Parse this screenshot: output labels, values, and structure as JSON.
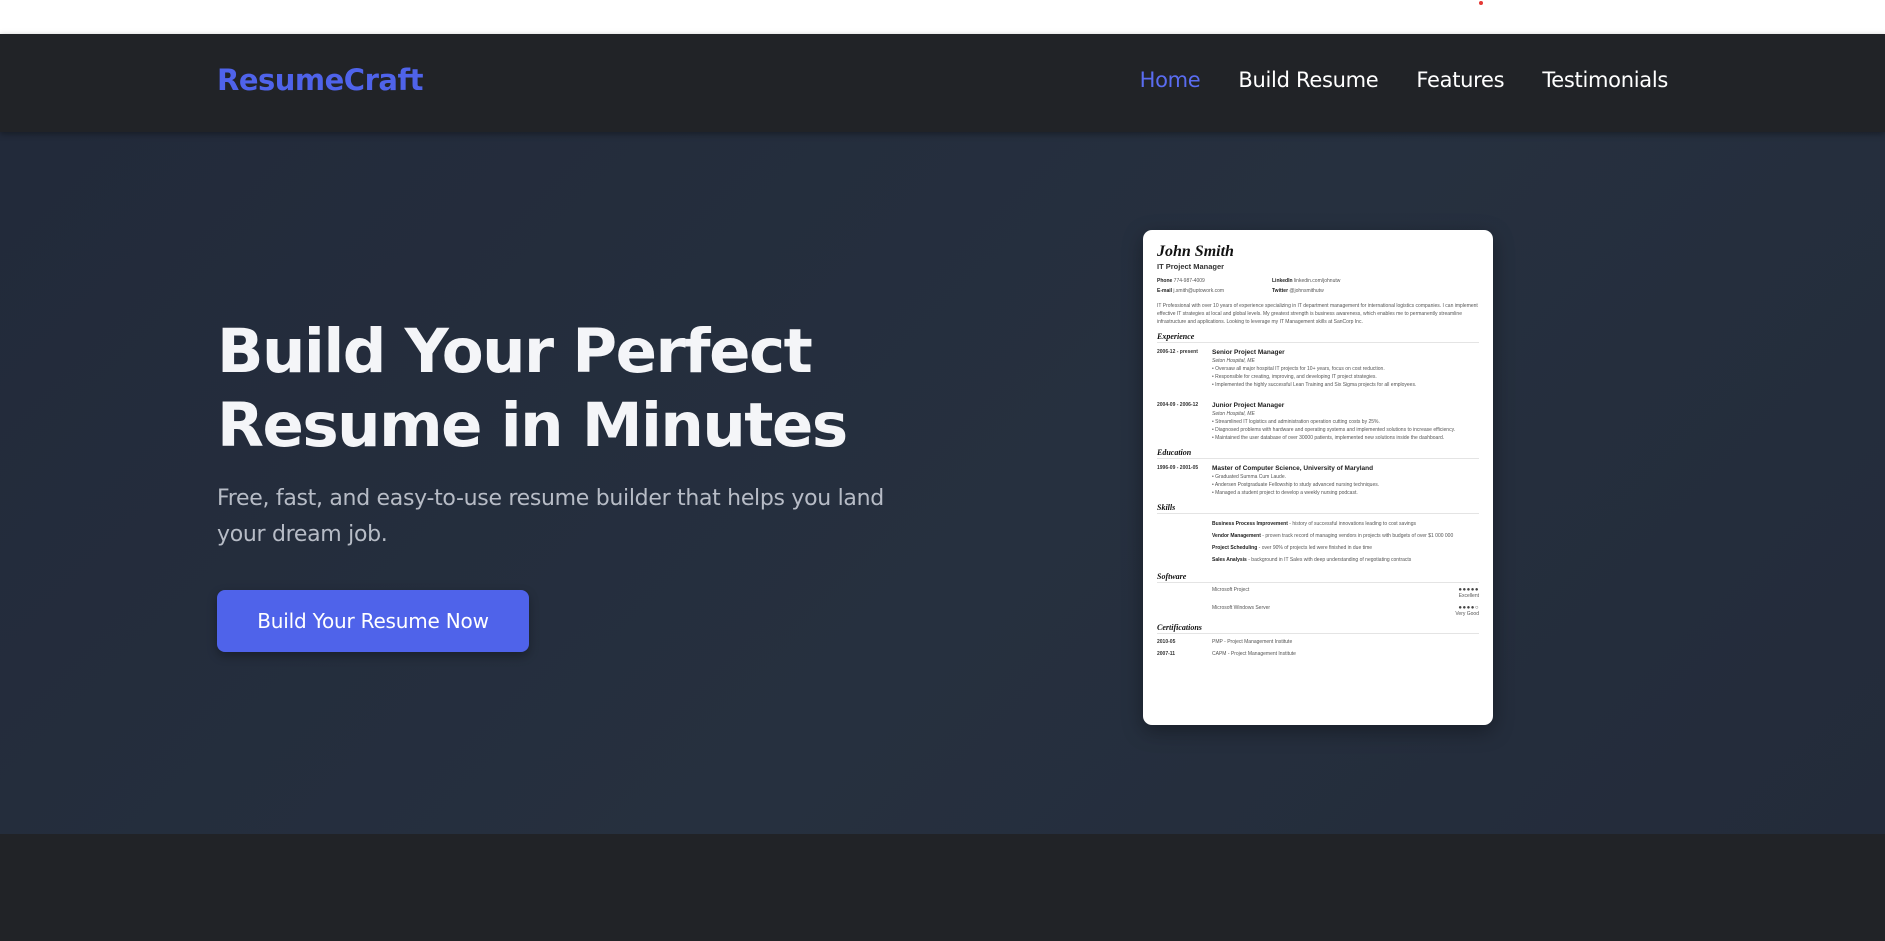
{
  "brand": {
    "logo": "ResumeCraft"
  },
  "nav": {
    "items": [
      "Home",
      "Build Resume",
      "Features",
      "Testimonials"
    ],
    "active": "Home"
  },
  "hero": {
    "title_line1": "Build Your Perfect",
    "title_line2": "Resume in Minutes",
    "subtitle": "Free, fast, and easy-to-use resume builder that helps you land your dream job.",
    "cta_label": "Build Your Resume Now"
  },
  "resume_preview": {
    "name": "John Smith",
    "role": "IT Project Manager",
    "contacts": {
      "phone_label": "Phone",
      "phone": "774-987-4009",
      "linkedin_label": "LinkedIn",
      "linkedin": "linkedin.com/johnutw",
      "email_label": "E-mail",
      "email": "j.smith@uptowork.com",
      "twitter_label": "Twitter",
      "twitter": "@johnsmithutw"
    },
    "summary": "IT Professional with over 10 years of experience specializing in IT department management for international logistics companies. I can implement effective IT strategies at local and global levels. My greatest strength is business awareness, which enables me to permanently streamline infrastructure and applications. Looking to leverage my IT Management skills at SanCorp Inc.",
    "sections": {
      "experience": "Experience",
      "education": "Education",
      "skills": "Skills",
      "software": "Software",
      "certifications": "Certifications"
    },
    "experience": [
      {
        "dates": "2006-12 - present",
        "title": "Senior Project Manager",
        "place": "Seton Hospital, ME",
        "bullets": [
          "• Oversaw all major hospital IT projects for 10+ years, focus on cost reduction.",
          "• Responsible for creating, improving, and developing IT project strategies.",
          "• Implemented the highly successful Lean Training and Six Sigma projects for all employees."
        ]
      },
      {
        "dates": "2004-09 - 2006-12",
        "title": "Junior Project Manager",
        "place": "Seton Hospital, ME",
        "bullets": [
          "• Streamlined IT logistics and administration operation cutting costs by 25%.",
          "• Diagnosed problems with hardware and operating systems and implemented solutions to increase efficiency.",
          "• Maintained the user database of over 30000 patients, implemented new solutions inside the dashboard."
        ]
      }
    ],
    "education": [
      {
        "dates": "1996-09 - 2001-05",
        "title": "Master of Computer Science, University of Maryland",
        "bullets": [
          "• Graduated Summa Cum Laude.",
          "• Andersen Postgraduate Fellowship to study advanced nursing techniques.",
          "• Managed a student project to develop a weekly nursing podcast."
        ]
      }
    ],
    "skills": [
      {
        "name": "Business Process Improvement",
        "desc": " - history of successful innovations leading to cost savings"
      },
      {
        "name": "Vendor Management",
        "desc": " - proven track record of managing vendors in projects with budgets of over $1 000 000"
      },
      {
        "name": "Project Scheduling",
        "desc": " - over 90% of projects led were finished in due time"
      },
      {
        "name": "Sales Analysis",
        "desc": " - background in IT Sales with deep understanding of negotiating contracts"
      }
    ],
    "software": [
      {
        "name": "Microsoft Project",
        "dots": "●●●●●",
        "level": "Excellent"
      },
      {
        "name": "Microsoft Windows Server",
        "dots": "●●●●○",
        "level": "Very Good"
      }
    ],
    "certifications": [
      {
        "date": "2010-05",
        "name": "PMP - Project Management Institute"
      },
      {
        "date": "2007-11",
        "name": "CAPM - Project Management Institute"
      }
    ]
  }
}
